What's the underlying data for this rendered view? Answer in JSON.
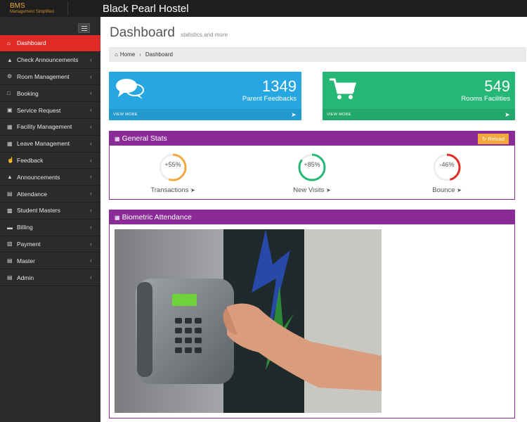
{
  "app": {
    "brand_name": "BMS",
    "brand_tagline": "Management Simplified",
    "title": "Black Pearl Hostel"
  },
  "sidebar": {
    "items": [
      {
        "label": "Dashboard",
        "icon": "home-icon",
        "active": true
      },
      {
        "label": "Check Announcements",
        "icon": "megaphone-icon"
      },
      {
        "label": "Room Management",
        "icon": "cogs-icon"
      },
      {
        "label": "Booking",
        "icon": "bookmark-icon"
      },
      {
        "label": "Service Request",
        "icon": "briefcase-icon"
      },
      {
        "label": "Facility Management",
        "icon": "table-icon"
      },
      {
        "label": "Leave Management",
        "icon": "table-icon"
      },
      {
        "label": "Feedback",
        "icon": "thumbs-up-icon"
      },
      {
        "label": "Announcements",
        "icon": "megaphone-icon"
      },
      {
        "label": "Attendance",
        "icon": "file-icon"
      },
      {
        "label": "Student Masters",
        "icon": "bar-chart-icon"
      },
      {
        "label": "Billing",
        "icon": "folder-icon"
      },
      {
        "label": "Payment",
        "icon": "grid-icon"
      },
      {
        "label": "Master",
        "icon": "file-icon"
      },
      {
        "label": "Admin",
        "icon": "file-icon"
      }
    ]
  },
  "page": {
    "title": "Dashboard",
    "subtitle": "statistics and more"
  },
  "breadcrumb": {
    "home": "Home",
    "current": "Dashboard"
  },
  "stats": [
    {
      "value": "1349",
      "label": "Parent Feedbacks",
      "footer": "VIEW MORE",
      "icon": "comments-icon",
      "color": "#27a7e1"
    },
    {
      "value": "549",
      "label": "Rooms Facilities",
      "footer": "VIEW MORE",
      "icon": "cart-icon",
      "color": "#26b776"
    }
  ],
  "general_stats": {
    "title": "General Stats",
    "reload_label": "Reload",
    "gauges": [
      {
        "percent": "+55%",
        "label": "Transactions",
        "fraction": 0.55,
        "color": "#f3a83b"
      },
      {
        "percent": "+85%",
        "label": "New Visits",
        "fraction": 0.85,
        "color": "#26b776"
      },
      {
        "percent": "-46%",
        "label": "Bounce",
        "fraction": 0.46,
        "color": "#e02b27"
      }
    ]
  },
  "biometric": {
    "title": "Biometric Attendance",
    "image": "biometric-scanner-photo"
  },
  "colors": {
    "accent_red": "#e02b27",
    "panel_purple": "#8a2b97",
    "sidebar_bg": "#2b2b2b"
  }
}
